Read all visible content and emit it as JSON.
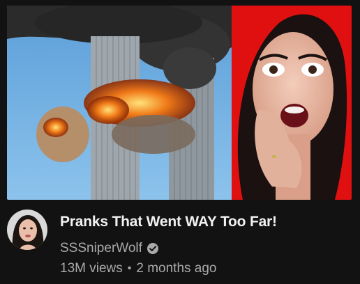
{
  "video": {
    "title": "Pranks That Went WAY Too Far!",
    "channel": "SSSniperWolf",
    "views": "13M views",
    "separator": "•",
    "age": "2 months ago"
  },
  "icons": {
    "verified": "verified-check-icon"
  },
  "colors": {
    "background": "#121212",
    "title": "#f1f1f1",
    "secondary_text": "#aaaaaa",
    "thumbnail_red_panel": "#e01010"
  }
}
